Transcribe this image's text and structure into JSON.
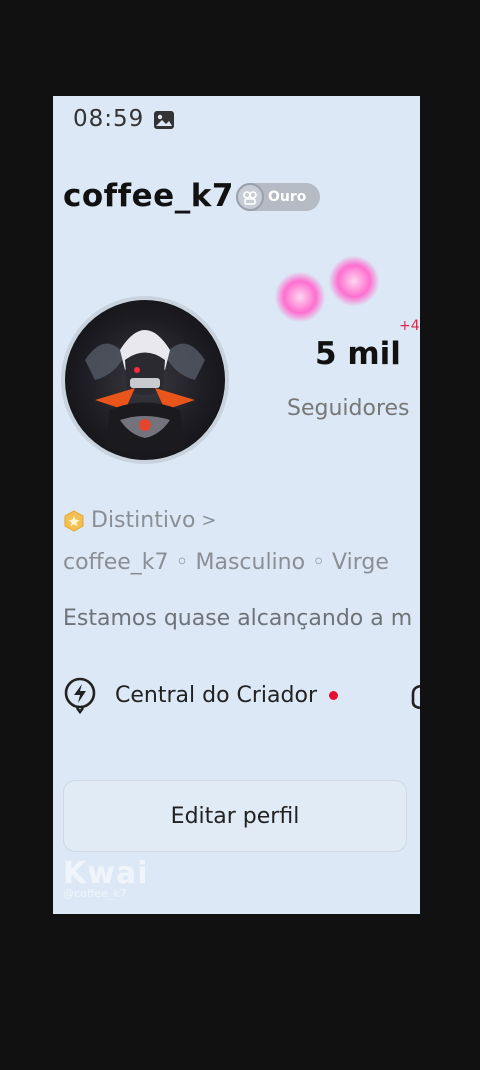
{
  "status_bar": {
    "time": "08:59",
    "icon": "image-icon"
  },
  "profile": {
    "username": "coffee_k7",
    "badge_label": "Ouro",
    "followers_count": "5 mil",
    "followers_label": "Seguidores",
    "followers_plus": "+4"
  },
  "distintivo": {
    "label": "Distintivo",
    "chevron": ">"
  },
  "info_line": "coffee_k7 ◦ Masculino ◦ Virge",
  "bio": "Estamos quase alcançando a m",
  "creator": {
    "label": "Central do Criador",
    "icon": "lightning-icon"
  },
  "edit_button": {
    "label": "Editar perfil"
  },
  "watermark": {
    "brand": "Kwai",
    "handle": "@coffee_k7"
  },
  "colors": {
    "screen_bg": "#dce8f5",
    "outer_bg": "#111111",
    "red_dot": "#e4102f",
    "sparkle": "#ff6fd0"
  }
}
